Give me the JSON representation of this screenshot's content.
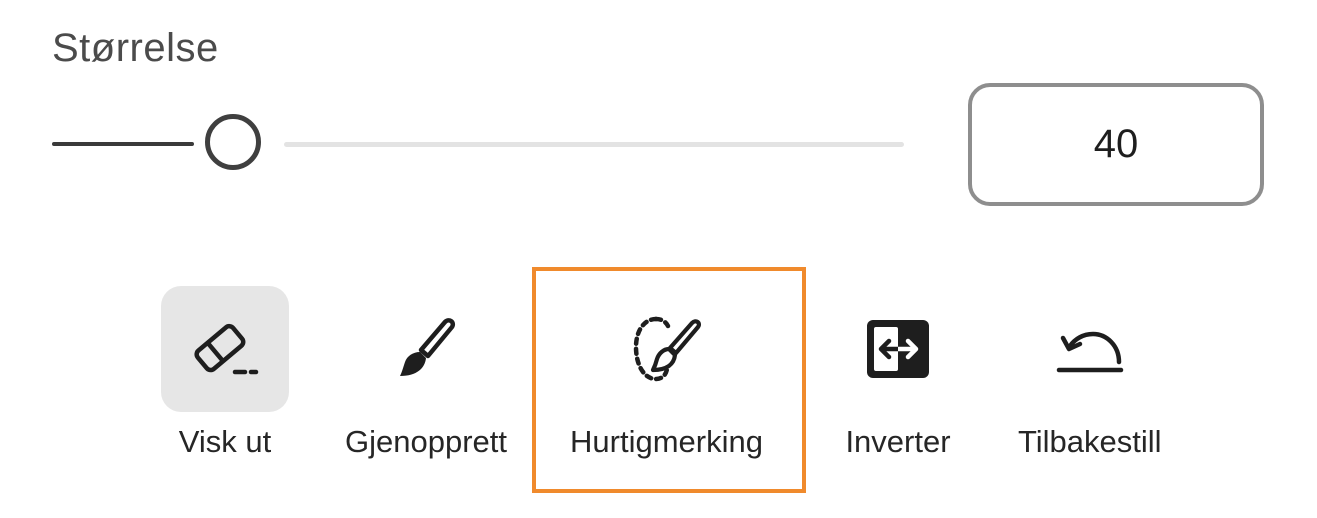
{
  "size": {
    "label": "Størrelse",
    "value": "40",
    "slider_fraction": 0.2
  },
  "tools": [
    {
      "label": "Visk ut",
      "icon": "eraser-icon",
      "selected": true
    },
    {
      "label": "Gjenopprett",
      "icon": "brush-icon",
      "selected": false
    },
    {
      "label": "Hurtigmerking",
      "icon": "quick-select-brush-icon",
      "selected": false,
      "highlighted": true
    },
    {
      "label": "Inverter",
      "icon": "invert-icon",
      "selected": false
    },
    {
      "label": "Tilbakestill",
      "icon": "reset-icon",
      "selected": false
    }
  ],
  "colors": {
    "highlight": "#f08a2c",
    "selected_background": "#e6e6e6"
  }
}
